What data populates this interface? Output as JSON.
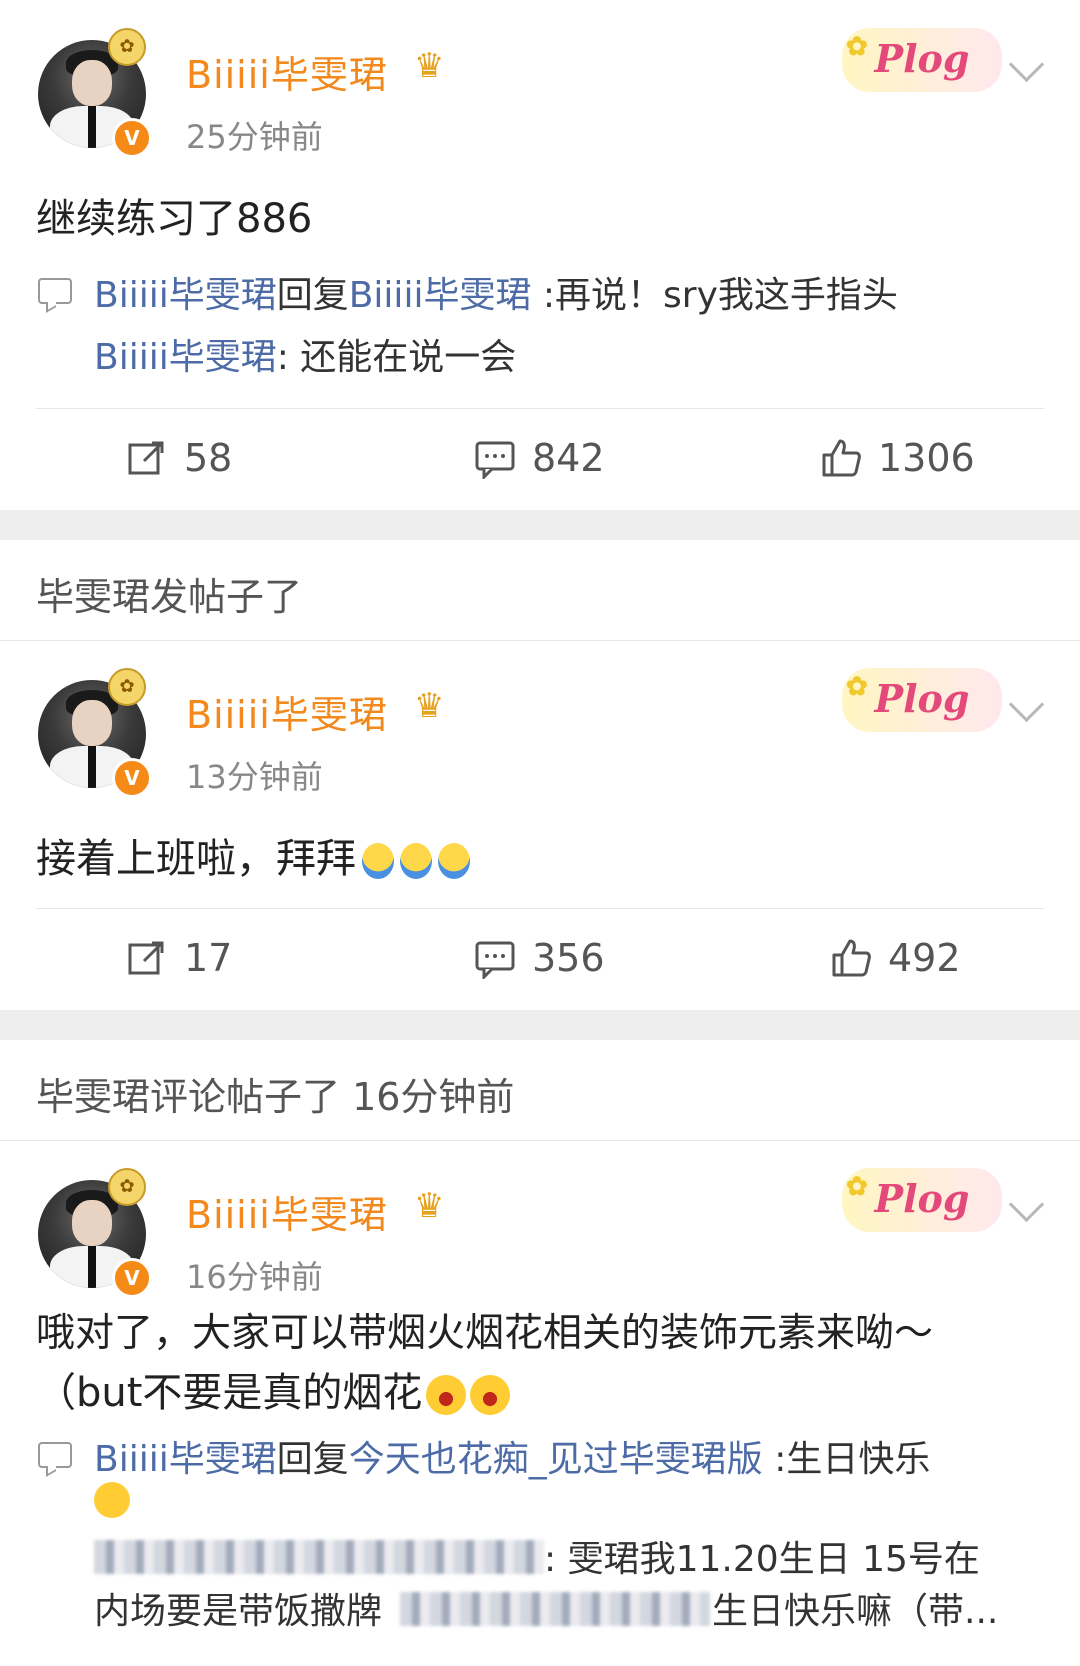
{
  "posts": [
    {
      "username": "Biiiii毕雯珺",
      "time": "25分钟前",
      "content": "继续练习了886",
      "reply": {
        "from": "Biiiii毕雯珺",
        "verb": "回复",
        "to": "Biiiii毕雯珺",
        "text": ":再说！sry我这手指头",
        "quote_user": "Biiiii毕雯珺",
        "quote_text": ": 还能在说一会"
      },
      "reposts": "58",
      "comments": "842",
      "likes": "1306"
    },
    {
      "section_label": "毕雯珺发帖子了",
      "username": "Biiiii毕雯珺",
      "time": "13分钟前",
      "content": "接着上班啦，拜拜",
      "reposts": "17",
      "comments": "356",
      "likes": "492"
    },
    {
      "section_label": "毕雯珺评论帖子了 16分钟前",
      "username": "Biiiii毕雯珺",
      "time": "16分钟前",
      "content_line1": "哦对了，大家可以带烟火烟花相关的装饰元素来呦～",
      "content_line2": "（but不要是真的烟花",
      "reply": {
        "from": "Biiiii毕雯珺",
        "verb": "回复",
        "to": "今天也花痴_见过毕雯珺版",
        "text": ":生日快乐",
        "quote_text": ": 雯珺我11.20生日 15号在",
        "quote_line2_start": "内场要是带饭撒牌",
        "quote_line2_end": "生日快乐嘛（带..."
      }
    }
  ],
  "badge": {
    "plog": "Plog",
    "verified": "V"
  },
  "icons": [
    "repost-icon",
    "comment-icon",
    "like-icon",
    "more-chevron-icon",
    "crown-badge-icon",
    "verified-icon"
  ]
}
